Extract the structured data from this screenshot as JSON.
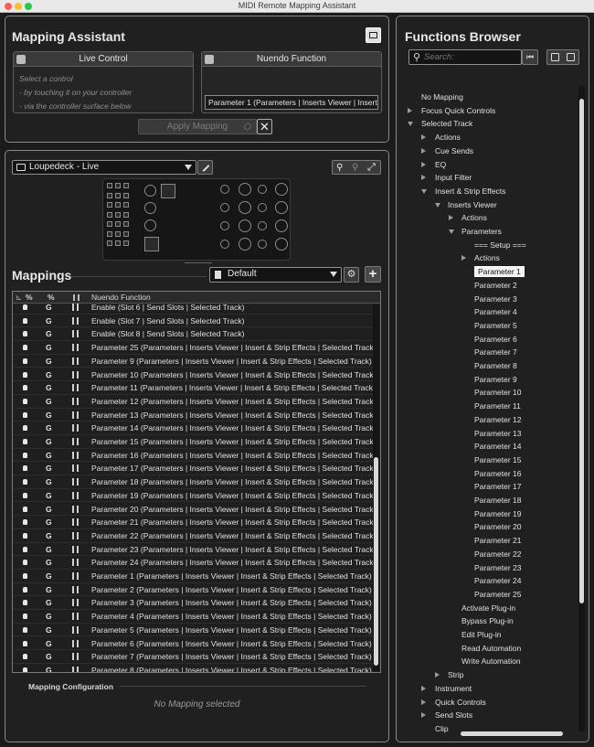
{
  "window": {
    "title": "MIDI Remote Mapping Assistant"
  },
  "mapping_assistant": {
    "title": "Mapping Assistant",
    "live_control": {
      "header": "Live Control",
      "hints": [
        "Select a control",
        "- by touching it on your controller",
        "- via the controller surface below"
      ]
    },
    "nuendo_function": {
      "header": "Nuendo Function",
      "value": "Parameter 1 (Parameters | Inserts Viewer | Insert &."
    },
    "apply_label": "Apply Mapping"
  },
  "controller": {
    "selected": "Loupedeck - Live"
  },
  "mappings": {
    "title": "Mappings",
    "page": "Default",
    "columns": [
      "%",
      "%",
      "",
      "Nuendo Function"
    ],
    "rows": [
      "Enable (Slot 6 | Send Slots | Selected Track)",
      "Enable (Slot 7 | Send Slots | Selected Track)",
      "Enable (Slot 8 | Send Slots | Selected Track)",
      "Parameter 25 (Parameters | Inserts Viewer | Insert & Strip Effects | Selected Track)",
      "Parameter 9 (Parameters | Inserts Viewer | Insert & Strip Effects | Selected Track)",
      "Parameter 10 (Parameters | Inserts Viewer | Insert & Strip Effects | Selected Track)",
      "Parameter 11 (Parameters | Inserts Viewer | Insert & Strip Effects | Selected Track)",
      "Parameter 12 (Parameters | Inserts Viewer | Insert & Strip Effects | Selected Track)",
      "Parameter 13 (Parameters | Inserts Viewer | Insert & Strip Effects | Selected Track)",
      "Parameter 14 (Parameters | Inserts Viewer | Insert & Strip Effects | Selected Track)",
      "Parameter 15 (Parameters | Inserts Viewer | Insert & Strip Effects | Selected Track)",
      "Parameter 16 (Parameters | Inserts Viewer | Insert & Strip Effects | Selected Track)",
      "Parameter 17 (Parameters | Inserts Viewer | Insert & Strip Effects | Selected Track)",
      "Parameter 18 (Parameters | Inserts Viewer | Insert & Strip Effects | Selected Track)",
      "Parameter 19 (Parameters | Inserts Viewer | Insert & Strip Effects | Selected Track)",
      "Parameter 20 (Parameters | Inserts Viewer | Insert & Strip Effects | Selected Track)",
      "Parameter 21 (Parameters | Inserts Viewer | Insert & Strip Effects | Selected Track)",
      "Parameter 22 (Parameters | Inserts Viewer | Insert & Strip Effects | Selected Track)",
      "Parameter 23 (Parameters | Inserts Viewer | Insert & Strip Effects | Selected Track)",
      "Parameter 24 (Parameters | Inserts Viewer | Insert & Strip Effects | Selected Track)",
      "Parameter 1 (Parameters | Inserts Viewer | Insert & Strip Effects | Selected Track)",
      "Parameter 2 (Parameters | Inserts Viewer | Insert & Strip Effects | Selected Track)",
      "Parameter 3 (Parameters | Inserts Viewer | Insert & Strip Effects | Selected Track)",
      "Parameter 4 (Parameters | Inserts Viewer | Insert & Strip Effects | Selected Track)",
      "Parameter 5 (Parameters | Inserts Viewer | Insert & Strip Effects | Selected Track)",
      "Parameter 6 (Parameters | Inserts Viewer | Insert & Strip Effects | Selected Track)",
      "Parameter 7 (Parameters | Inserts Viewer | Insert & Strip Effects | Selected Track)",
      "Parameter 8 (Parameters | Inserts Viewer | Insert & Strip Effects | Selected Track)"
    ],
    "col2_letter": "G"
  },
  "mapping_configuration": {
    "title": "Mapping Configuration",
    "empty": "No Mapping selected"
  },
  "functions_browser": {
    "title": "Functions Browser",
    "search_placeholder": "Search:",
    "tree": [
      {
        "label": "No Mapping",
        "level": 0,
        "arrow": "none"
      },
      {
        "label": "Focus Quick Controls",
        "level": 0,
        "arrow": "right"
      },
      {
        "label": "Selected Track",
        "level": 0,
        "arrow": "down"
      },
      {
        "label": "Actions",
        "level": 1,
        "arrow": "right"
      },
      {
        "label": "Cue Sends",
        "level": 1,
        "arrow": "right"
      },
      {
        "label": "EQ",
        "level": 1,
        "arrow": "right"
      },
      {
        "label": "Input Filter",
        "level": 1,
        "arrow": "right"
      },
      {
        "label": "Insert & Strip Effects",
        "level": 1,
        "arrow": "down"
      },
      {
        "label": "Inserts Viewer",
        "level": 2,
        "arrow": "down"
      },
      {
        "label": "Actions",
        "level": 3,
        "arrow": "right"
      },
      {
        "label": "Parameters",
        "level": 3,
        "arrow": "down"
      },
      {
        "label": "=== Setup ===",
        "level": 4,
        "arrow": "none"
      },
      {
        "label": "Actions",
        "level": 4,
        "arrow": "right"
      },
      {
        "label": "Parameter 1",
        "level": 5,
        "arrow": "none",
        "selected": true
      },
      {
        "label": "Parameter 2",
        "level": 5,
        "arrow": "none"
      },
      {
        "label": "Parameter 3",
        "level": 5,
        "arrow": "none"
      },
      {
        "label": "Parameter 4",
        "level": 5,
        "arrow": "none"
      },
      {
        "label": "Parameter 5",
        "level": 5,
        "arrow": "none"
      },
      {
        "label": "Parameter 6",
        "level": 5,
        "arrow": "none"
      },
      {
        "label": "Parameter 7",
        "level": 5,
        "arrow": "none"
      },
      {
        "label": "Parameter 8",
        "level": 5,
        "arrow": "none"
      },
      {
        "label": "Parameter 9",
        "level": 5,
        "arrow": "none"
      },
      {
        "label": "Parameter 10",
        "level": 5,
        "arrow": "none"
      },
      {
        "label": "Parameter 11",
        "level": 5,
        "arrow": "none"
      },
      {
        "label": "Parameter 12",
        "level": 5,
        "arrow": "none"
      },
      {
        "label": "Parameter 13",
        "level": 5,
        "arrow": "none"
      },
      {
        "label": "Parameter 14",
        "level": 5,
        "arrow": "none"
      },
      {
        "label": "Parameter 15",
        "level": 5,
        "arrow": "none"
      },
      {
        "label": "Parameter 16",
        "level": 5,
        "arrow": "none"
      },
      {
        "label": "Parameter 17",
        "level": 5,
        "arrow": "none"
      },
      {
        "label": "Parameter 18",
        "level": 5,
        "arrow": "none"
      },
      {
        "label": "Parameter 19",
        "level": 5,
        "arrow": "none"
      },
      {
        "label": "Parameter 20",
        "level": 5,
        "arrow": "none"
      },
      {
        "label": "Parameter 21",
        "level": 5,
        "arrow": "none"
      },
      {
        "label": "Parameter 22",
        "level": 5,
        "arrow": "none"
      },
      {
        "label": "Parameter 23",
        "level": 5,
        "arrow": "none"
      },
      {
        "label": "Parameter 24",
        "level": 5,
        "arrow": "none"
      },
      {
        "label": "Parameter 25",
        "level": 5,
        "arrow": "none"
      },
      {
        "label": "Activate Plug-in",
        "level": 3,
        "arrow": "none"
      },
      {
        "label": "Bypass Plug-in",
        "level": 3,
        "arrow": "none"
      },
      {
        "label": "Edit Plug-in",
        "level": 3,
        "arrow": "none"
      },
      {
        "label": "Read Automation",
        "level": 3,
        "arrow": "none"
      },
      {
        "label": "Write Automation",
        "level": 3,
        "arrow": "none"
      },
      {
        "label": "Strip",
        "level": 2,
        "arrow": "right"
      },
      {
        "label": "Instrument",
        "level": 1,
        "arrow": "right"
      },
      {
        "label": "Quick Controls",
        "level": 1,
        "arrow": "right"
      },
      {
        "label": "Send Slots",
        "level": 1,
        "arrow": "right"
      },
      {
        "label": "Clip",
        "level": 1,
        "arrow": "none"
      }
    ]
  }
}
